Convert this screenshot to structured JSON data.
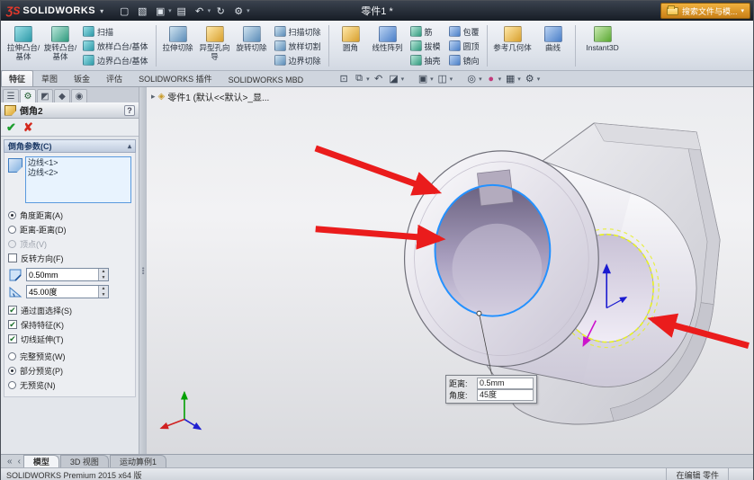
{
  "titlebar": {
    "logo_mark": "ƷS",
    "logo_text": "SOLIDWORKS",
    "doc_title": "零件1 *",
    "search_text": "搜索文件与模..."
  },
  "icons": {
    "new": "▢",
    "open": "▧",
    "save": "▣",
    "print": "▤",
    "undo": "↶",
    "rebuild": "↻",
    "options": "⚙",
    "dropdown": "▾",
    "zoom_fit": "⊡",
    "zoom_area": "⧉",
    "previous_view": "↶",
    "section_view": "◪",
    "view_orientation": "▣",
    "display_style": "◫",
    "hide_show": "◎",
    "appearance": "●",
    "scene": "▦",
    "view_settings": "⚙",
    "pm_tree": "☰",
    "pm_property": "⚙",
    "pm_config": "◩",
    "pm_dimxpert": "◆",
    "pm_display": "◉",
    "ok": "✔",
    "cancel": "✘",
    "help": "?",
    "group_chevron": "▴",
    "tree_expand": "▸",
    "part": "◈",
    "nav_first": "«",
    "nav_prev": "‹",
    "spin_up": "▲",
    "spin_down": "▼"
  },
  "ribbon": {
    "g1_large": [
      "拉伸凸台/基体",
      "旋转凸台/基体"
    ],
    "g1_small": [
      "扫描",
      "放样凸台/基体",
      "边界凸台/基体"
    ],
    "g2_large": [
      "拉伸切除",
      "异型孔向导",
      "旋转切除"
    ],
    "g2_small": [
      "扫描切除",
      "放样切割",
      "边界切除"
    ],
    "g3_large": [
      "圆角",
      "线性阵列"
    ],
    "g3_small_a": [
      "筋",
      "拔模",
      "抽壳"
    ],
    "g3_small_b": [
      "包覆",
      "圆顶",
      "镜向"
    ],
    "g4_large": [
      "参考几何体",
      "曲线"
    ],
    "g5_large": [
      "Instant3D"
    ]
  },
  "tabs": {
    "items": [
      "特征",
      "草图",
      "钣金",
      "评估",
      "SOLIDWORKS 插件",
      "SOLIDWORKS MBD"
    ],
    "active": "特征"
  },
  "pm": {
    "title": "倒角2",
    "params_header": "倒角参数(C)",
    "selections": [
      "边线<1>",
      "边线<2>"
    ],
    "mode_options": [
      {
        "label": "角度距离(A)",
        "selected": true,
        "enabled": true
      },
      {
        "label": "距离-距离(D)",
        "selected": false,
        "enabled": true
      },
      {
        "label": "顶点(V)",
        "selected": false,
        "enabled": false
      }
    ],
    "flip_label": "反转方向(F)",
    "distance_value": "0.50mm",
    "angle_value": "45.00度",
    "options": [
      {
        "label": "通过面选择(S)",
        "checked": true
      },
      {
        "label": "保持特征(K)",
        "checked": true
      },
      {
        "label": "切线延伸(T)",
        "checked": true
      }
    ],
    "preview_options": [
      {
        "label": "完整预览(W)",
        "selected": false
      },
      {
        "label": "部分预览(P)",
        "selected": true
      },
      {
        "label": "无预览(N)",
        "selected": false
      }
    ]
  },
  "viewport": {
    "tree_label": "零件1 (默认<<默认>_显...",
    "callout": {
      "distance_label": "距离:",
      "distance_value": "0.5mm",
      "angle_label": "角度:",
      "angle_value": "45度"
    },
    "colors": {
      "selected_edge": "#2491ff",
      "preview_edge": "#e6f02a",
      "annotation_arrow": "#ea1c1c",
      "flip_handle": "#cc14cc"
    }
  },
  "bottom_tabs": {
    "items": [
      "模型",
      "3D 视图",
      "运动算例1"
    ],
    "active": "模型"
  },
  "statusbar": {
    "left": "SOLIDWORKS Premium 2015 x64 版",
    "mode": "在编辑 零件"
  }
}
